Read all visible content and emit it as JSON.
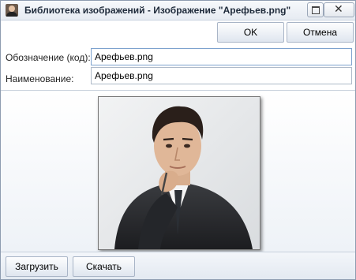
{
  "window": {
    "title": "Библиотека изображений - Изображение \"Арефьев.png\"",
    "app_icon": "person-photo-icon",
    "restore_icon": "restore-icon",
    "close_icon": "close-icon"
  },
  "toolbar": {
    "ok_label": "OK",
    "cancel_label": "Отмена"
  },
  "form": {
    "code_label": "Обозначение (код):",
    "code_value": "Арефьев.png",
    "name_label": "Наименование:",
    "name_value": "Арефьев.png"
  },
  "image": {
    "subject": "portrait-photo"
  },
  "footer": {
    "upload_label": "Загрузить",
    "download_label": "Скачать"
  }
}
